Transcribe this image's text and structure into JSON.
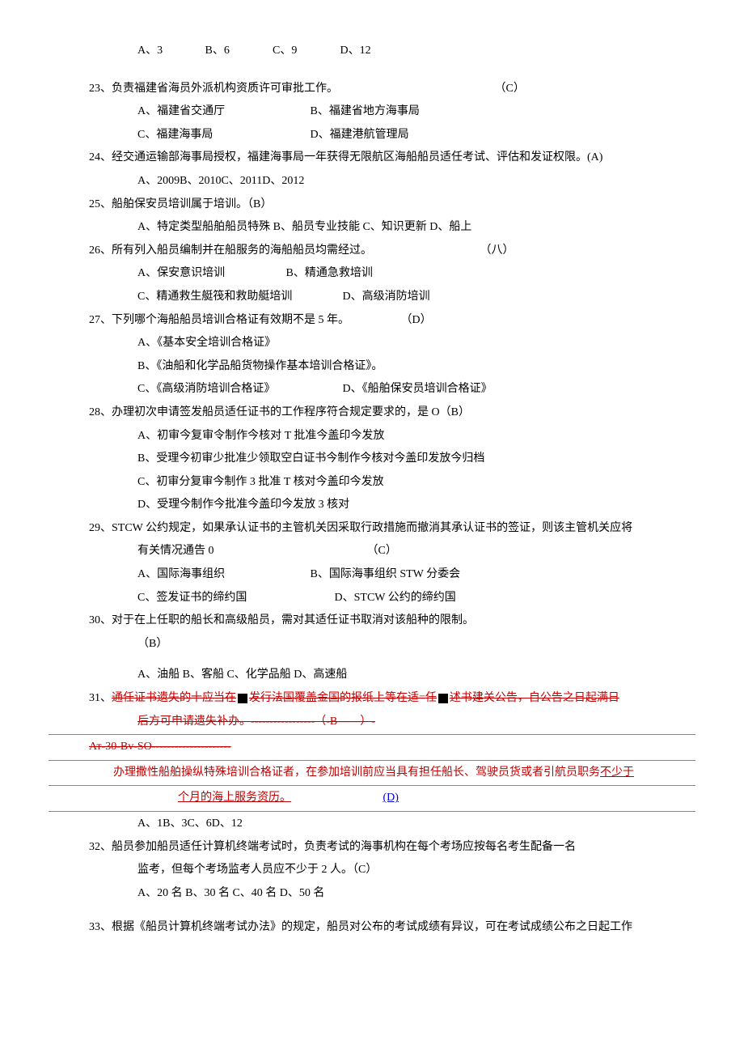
{
  "line22opts": {
    "a": "A、3",
    "b": "B、6",
    "c": "C、9",
    "d": "D、12"
  },
  "q23": {
    "text": "23、负责福建省海员外派机构资质许可审批工作。",
    "ans": "（C）",
    "a": "A、福建省交通厅",
    "b": "B、福建省地方海事局",
    "c": "C、福建海事局",
    "d": "D、福建港航管理局"
  },
  "q24": {
    "text": "24、经交通运输部海事局授权，福建海事局一年获得无限航区海船船员适任考试、评估和发证权限。(A)",
    "opts": "A、2009B、2010C、2011D、2012"
  },
  "q25": {
    "text": "25、船舶保安员培训属于培训。（B）",
    "opts": "A、特定类型船舶船员特殊 B、船员专业技能 C、知识更新 D、船上"
  },
  "q26": {
    "text": "26、所有列入船员编制并在船服务的海船船员均需经过。",
    "ans": "（八）",
    "a": "A、保安意识培训",
    "b": "B、精通急救培训",
    "c": "C、精通救生艇筏和救助艇培训",
    "d": "D、高级消防培训"
  },
  "q27": {
    "text": "27、下列哪个海船船员培训合格证有效期不是 5 年。",
    "ans": "（D）",
    "a": "A、《基本安全培训合格证》",
    "b": "B、《油船和化学品船货物操作基本培训合格证》。",
    "c": "C、《高级消防培训合格证》",
    "d": "D、《船舶保安员培训合格证》"
  },
  "q28": {
    "text": "28、办理初次申请签发船员适任证书的工作程序符合规定要求的，是 O（B）",
    "a": "A、初审今复审令制作今核对 T 批准今盖印今发放",
    "b": "B、受理今初审少批准少领取空白证书今制作今核对今盖印发放今归档",
    "c": "C、初审分复审今制作 3 批准 T 核对今盖印今发放",
    "d": "D、受理今制作今批准今盖印今发放 3 核对"
  },
  "q29": {
    "text1": "29、STCW 公约规定，如果承认证书的主管机关因采取行政措施而撤消其承认证书的签证，则该主管机关应将",
    "text2": "有关情况通告 0",
    "ans": "（C）",
    "a": "A、国际海事组织",
    "b": "B、国际海事组织 STW 分委会",
    "c": "C、签发证书的缔约国",
    "d": "D、STCW 公约的缔约国"
  },
  "q30": {
    "text": "30、对于在上任职的船长和高级船员，需对其适任证书取消对该船种的限制。",
    "ans": "（B）",
    "opts": "A、油船 B、客船 C、化学品船 D、高速船"
  },
  "q31": {
    "prefix": "31、",
    "line1a": "通任证书遗失的十应当在",
    "line1b": "发行法国覆盖金国的报纸上等在适=任",
    "line1c": "述书建关公告，自公告之日起满日",
    "line2": "后方可申请遗失补办。-----------------（-B——）-",
    "line3": "Ат-30-Bv-SO---------------------",
    "line4a": "办理撒性船舶操纵特殊培训合格证者，在参加培训前应当具有担任船长、驾驶员货或者引航员职务",
    "line4b": "不少于",
    "line5": "个月的海上服务资历。",
    "ans5": "(D)",
    "opts": "A、1B、3C、6D、12"
  },
  "q32": {
    "text1": "32、船员参加船员适任计算机终端考试时，负责考试的海事机构在每个考场应按每名考生配备一名",
    "text2": "监考，但每个考场监考人员应不少于 2 人。（C）",
    "opts": "A、20 名 B、30 名 C、40 名 D、50 名"
  },
  "q33": {
    "text": "33、根据《船员计算机终端考试办法》的规定，船员对公布的考试成绩有异议，可在考试成绩公布之日起工作"
  }
}
